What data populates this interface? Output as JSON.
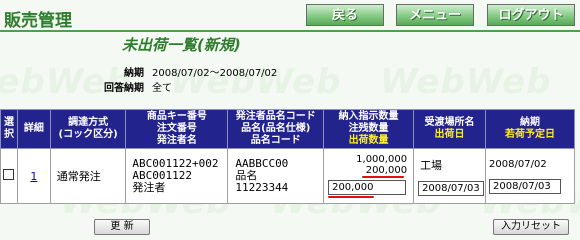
{
  "header": {
    "app_title": "販売管理",
    "back_label": "戻る",
    "menu_label": "メニュー",
    "logout_label": "ログアウト"
  },
  "page_title": "未出荷一覧(新規)",
  "background": {
    "watermark_text": "WebWeb"
  },
  "filters": {
    "delivery_label": "納期",
    "delivery_value": "2008/07/02〜2008/07/02",
    "answer_label": "回答納期",
    "answer_value": "全て"
  },
  "table": {
    "headers": {
      "select": [
        "選",
        "択"
      ],
      "detail": "詳細",
      "procurement": [
        "調達方式",
        "(コック区分)"
      ],
      "product": [
        "商品キー番号",
        "注文番号",
        "発注者名"
      ],
      "order_product": [
        "発注者品名コード",
        "品名(品名仕様)",
        "品名コード"
      ],
      "quantity": [
        "納入指示数量",
        "注残数量",
        "出荷数量"
      ],
      "place": [
        "受渡場所名",
        "出荷日"
      ],
      "delivery": [
        "納期",
        "若荷予定日"
      ]
    },
    "rows": [
      {
        "detail_link": "1",
        "procurement": "通常発注",
        "product_key": "ABC001122+002",
        "order_no": "ABC001122",
        "orderer": "発注者",
        "product_code": "AABBCC00",
        "product_name": "品名",
        "product_number": "11223344",
        "instructed_qty": "1,000,000",
        "remaining_qty": "200,000",
        "ship_qty": "200,000",
        "place": "工場",
        "ship_date": "2008/07/03",
        "delivery_date": "2008/07/02",
        "scheduled_date": "2008/07/03"
      }
    ]
  },
  "buttons": {
    "update_label": "更 新",
    "reset_label": "入力リセット"
  },
  "colors": {
    "header_bg": "#23238e",
    "accent_green": "#2e7d2e",
    "highlight": "#ffee22",
    "annotation_red": "#e01010"
  }
}
